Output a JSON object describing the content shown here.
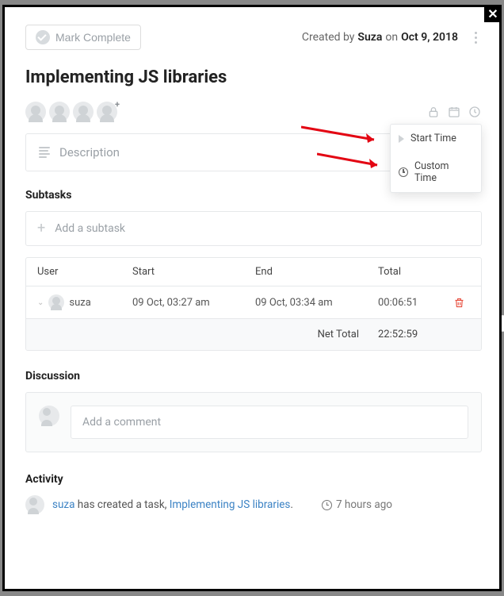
{
  "header": {
    "mark_complete_label": "Mark Complete",
    "created_by_prefix": "Created by",
    "created_by_user": "Suza",
    "created_on_prefix": "on",
    "created_on_date": "Oct 9, 2018"
  },
  "title": "Implementing JS libraries",
  "description_placeholder": "Description",
  "subtasks": {
    "heading": "Subtasks",
    "add_placeholder": "Add a subtask"
  },
  "time_table": {
    "headers": {
      "user": "User",
      "start": "Start",
      "end": "End",
      "total": "Total"
    },
    "rows": [
      {
        "user": "suza",
        "start": "09 Oct, 03:27 am",
        "end": "09 Oct, 03:34 am",
        "total": "00:06:51"
      }
    ],
    "net_label": "Net Total",
    "net_value": "22:52:59"
  },
  "discussion": {
    "heading": "Discussion",
    "comment_placeholder": "Add a comment"
  },
  "activity": {
    "heading": "Activity",
    "user": "suza",
    "text_mid": " has created a task, ",
    "task_name": "Implementing JS libraries",
    "period": ".",
    "ago": "7 hours ago"
  },
  "popover": {
    "start_time": "Start Time",
    "custom_time": "Custom Time"
  },
  "bg": {
    "snip_time": "22:5"
  }
}
